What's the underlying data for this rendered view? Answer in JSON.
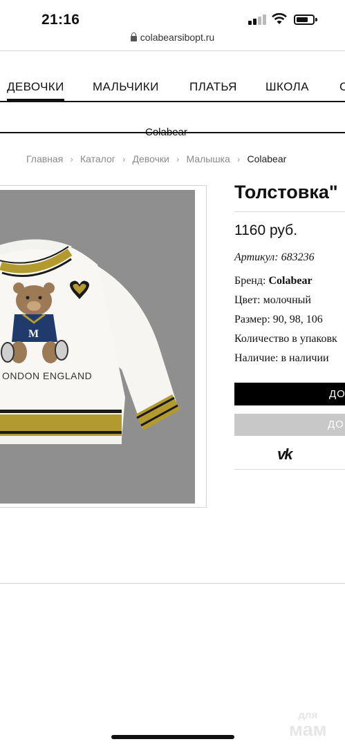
{
  "status_bar": {
    "time": "21:16"
  },
  "browser": {
    "url": "colabearsibopt.ru"
  },
  "nav": {
    "items": [
      "ДЕВОЧКИ",
      "МАЛЬЧИКИ",
      "ПЛАТЬЯ",
      "ШКОЛА",
      "С"
    ],
    "active": "ДЕВОЧКИ"
  },
  "brand_title": "Colabear",
  "breadcrumbs": [
    "Главная",
    "Каталог",
    "Девочки",
    "Малышка",
    "Colabear"
  ],
  "product": {
    "title": "Толстовка\"",
    "price": "1160 руб.",
    "sku_label": "Артикул:",
    "sku": "683236",
    "brand_label": "Бренд:",
    "brand": "Colabear",
    "color_label": "Цвет:",
    "color": "молочный",
    "size_label": "Размер:",
    "sizes": "90, 98, 106",
    "qty_label": "Количество в упаковк",
    "availability_label": "Наличие:",
    "availability": "в наличии",
    "image_text": "ONDON ENGLAND"
  },
  "buttons": {
    "primary": "ДО",
    "secondary": "ДО"
  },
  "share": {
    "vk": "vk"
  },
  "watermark": {
    "line1": "для",
    "line2": "мам"
  },
  "colors": {
    "button_black": "#000000",
    "button_gray": "#c8c8c8",
    "stripe_mustard": "#b39a2e"
  }
}
